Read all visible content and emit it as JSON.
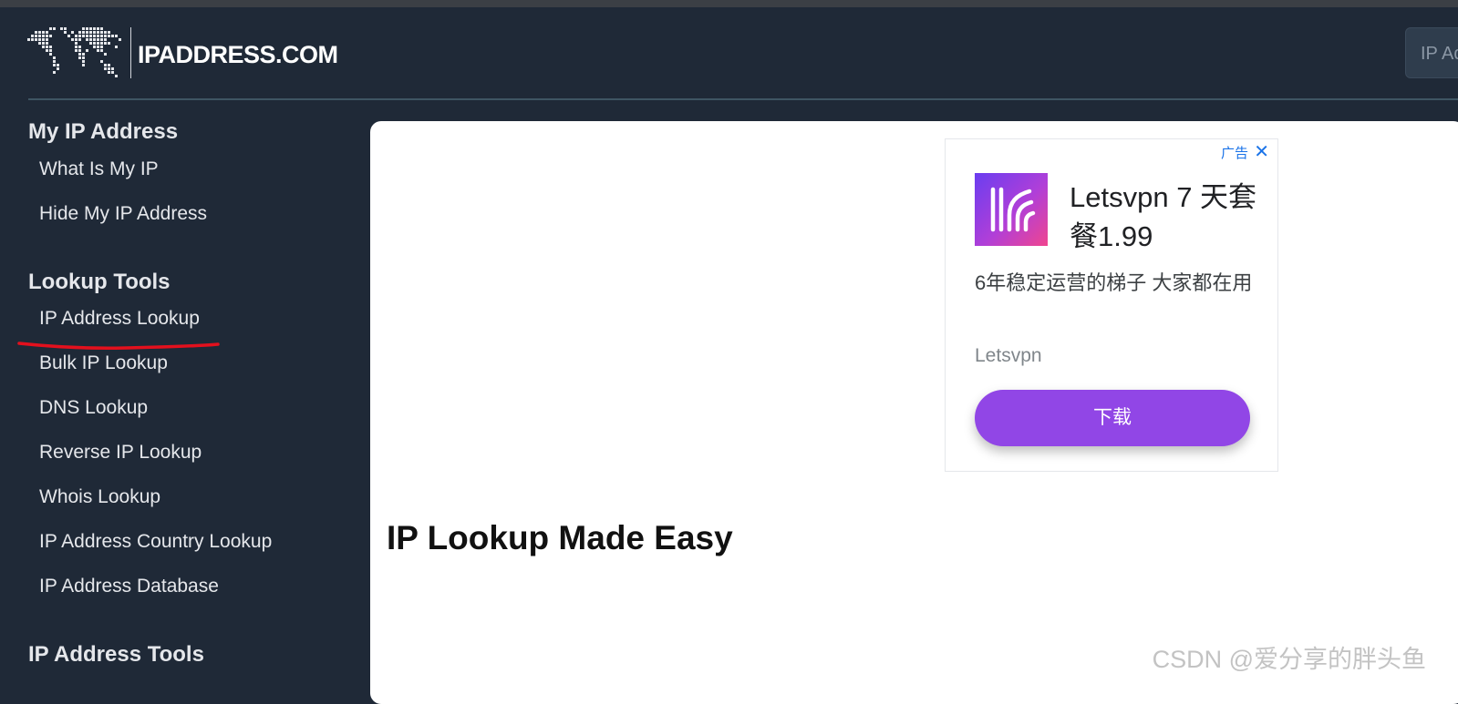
{
  "header": {
    "logo_text": "IPADDRESS.COM",
    "search_placeholder": "IP Ad"
  },
  "sidebar": {
    "sections": [
      {
        "heading": "My IP Address",
        "links": [
          "What Is My IP",
          "Hide My IP Address"
        ]
      },
      {
        "heading": "Lookup Tools",
        "links": [
          "IP Address Lookup",
          "Bulk IP Lookup",
          "DNS Lookup",
          "Reverse IP Lookup",
          "Whois Lookup",
          "IP Address Country Lookup",
          "IP Address Database"
        ]
      },
      {
        "heading": "IP Address Tools",
        "links": []
      }
    ]
  },
  "ad": {
    "label": "广告",
    "close_icon": "close-icon",
    "title": "Letsvpn 7 天套餐1.99",
    "description": "6年稳定运营的梯子 大家都在用",
    "brand": "Letsvpn",
    "button_label": "下载",
    "button_color": "#9146e6"
  },
  "main": {
    "heading": "IP Lookup Made Easy"
  },
  "watermark": "CSDN @爱分享的胖头鱼",
  "colors": {
    "background": "#1f2937",
    "annotation": "#e3101d"
  }
}
